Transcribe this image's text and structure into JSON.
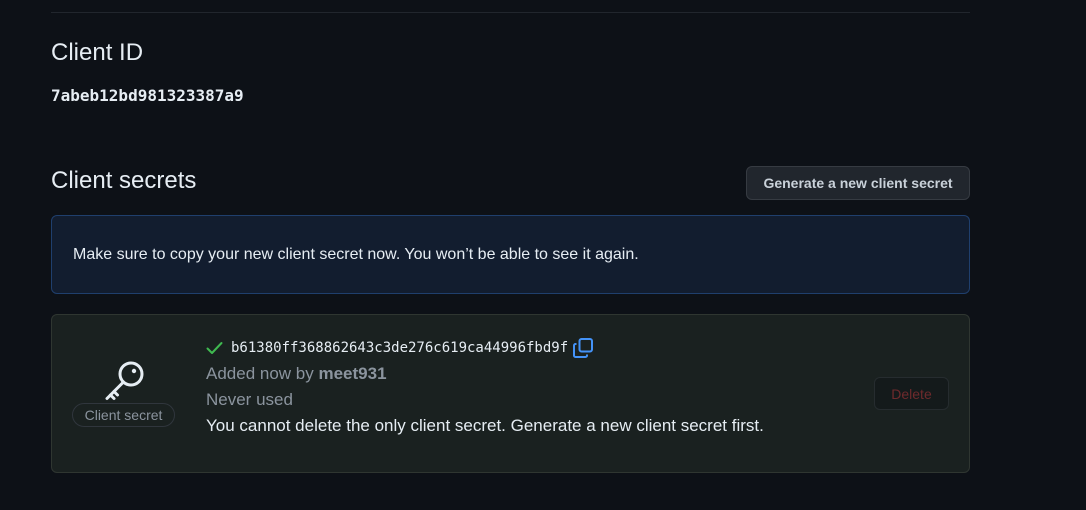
{
  "client_id": {
    "title": "Client ID",
    "value": "7abeb12bd981323387a9"
  },
  "client_secrets": {
    "title": "Client secrets",
    "generate_button_label": "Generate a new client secret",
    "flash_message": "Make sure to copy your new client secret now. You won’t be able to see it again.",
    "secret": {
      "badge_label": "Client secret",
      "value": "b61380ff368862643c3de276c619ca44996fbd9f",
      "added_prefix": "Added now by ",
      "added_by": "meet931",
      "usage": "Never used",
      "delete_warning": "You cannot delete the only client secret. Generate a new client secret first.",
      "delete_button_label": "Delete"
    }
  },
  "colors": {
    "background": "#0d1117",
    "check_green": "#3fb950",
    "copy_blue": "#4493f8",
    "delete_disabled_red": "#6e2a2c"
  },
  "icons": {
    "key": "key-icon",
    "check": "check-icon",
    "copy": "copy-icon"
  }
}
